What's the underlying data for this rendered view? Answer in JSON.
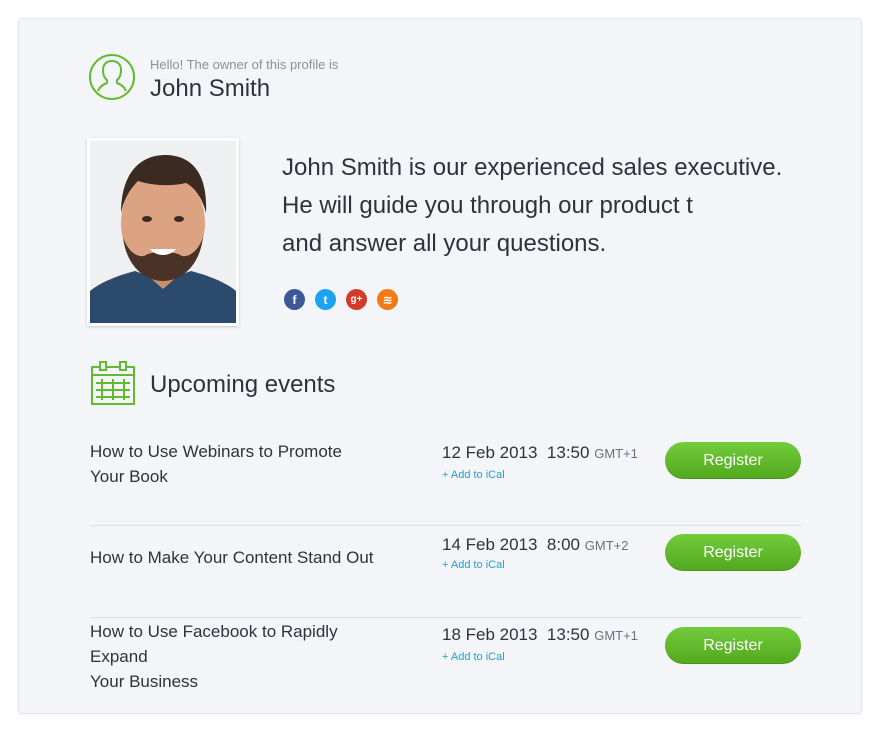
{
  "owner": {
    "greeting": "Hello! The owner of this profile is",
    "name": "John Smith"
  },
  "bio": {
    "lines": [
      "John Smith is our experienced sales executive.",
      "He will guide you through our product t",
      "and answer all your questions."
    ]
  },
  "social": [
    {
      "icon": "facebook-icon",
      "glyph": "f",
      "color": "#3b5998"
    },
    {
      "icon": "twitter-icon",
      "glyph": "t",
      "color": "#1da1f2"
    },
    {
      "icon": "google-plus-icon",
      "glyph": "g+",
      "color": "#d23a2b"
    },
    {
      "icon": "rss-icon",
      "glyph": "≋",
      "color": "#f07b16"
    }
  ],
  "events_section": {
    "title": "Upcoming events",
    "events": [
      {
        "title_lines": [
          "How to Use Webinars to Promote",
          "Your Book"
        ],
        "date": "12 Feb 2013",
        "time": "13:50",
        "tz": "GMT+1",
        "ical": "+ Add to iCal",
        "register": "Register"
      },
      {
        "title_lines": [
          "How to Make Your Content Stand Out"
        ],
        "date": "14 Feb 2013",
        "time": "8:00",
        "tz": "GMT+2",
        "ical": "+ Add to iCal",
        "register": "Register"
      },
      {
        "title_lines": [
          "How to Use Facebook to Rapidly Expand",
          "Your Business"
        ],
        "date": "18 Feb 2013",
        "time": "13:50",
        "tz": "GMT+1",
        "ical": "+ Add to iCal",
        "register": "Register"
      }
    ]
  },
  "colors": {
    "accent_green": "#62bb2e",
    "link_blue": "#1ea0d8",
    "card_bg": "#f3f5f9"
  }
}
